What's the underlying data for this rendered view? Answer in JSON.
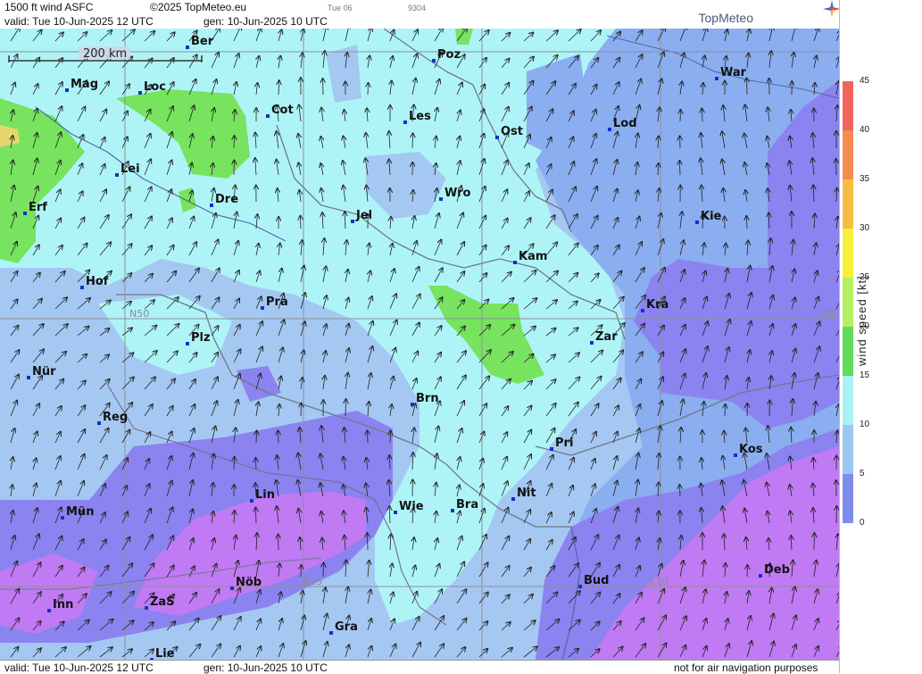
{
  "header": {
    "product": "1500 ft wind ASFC",
    "copyright": "©2025 TopMeteo.eu",
    "valid": "valid:  Tue  10-Jun-2025  12 UTC",
    "generated": "gen: 10-Jun-2025 10 UTC",
    "small_day": "Tue 06",
    "small_code": "9304",
    "brand": "TopMeteo"
  },
  "footer": {
    "valid": "valid:  Tue  10-Jun-2025  12 UTC",
    "generated": "gen: 10-Jun-2025 10 UTC",
    "disclaimer": "not for air navigation purposes"
  },
  "map": {
    "scale_label": "200 km",
    "grid_labels": [
      "N50",
      "N5",
      "E15",
      "E20"
    ],
    "cities": [
      {
        "name": "Ber"
      },
      {
        "name": "Poz"
      },
      {
        "name": "War"
      },
      {
        "name": "Mag"
      },
      {
        "name": "Loc"
      },
      {
        "name": "Cot"
      },
      {
        "name": "Les"
      },
      {
        "name": "Lod"
      },
      {
        "name": "Ost"
      },
      {
        "name": "Lei"
      },
      {
        "name": "Wro"
      },
      {
        "name": "Dre"
      },
      {
        "name": "Erf"
      },
      {
        "name": "Jel"
      },
      {
        "name": "Kie"
      },
      {
        "name": "Kam"
      },
      {
        "name": "Hof"
      },
      {
        "name": "Pra"
      },
      {
        "name": "Kra"
      },
      {
        "name": "Zar"
      },
      {
        "name": "Plz"
      },
      {
        "name": "Nür"
      },
      {
        "name": "Brn"
      },
      {
        "name": "Reg"
      },
      {
        "name": "Pri"
      },
      {
        "name": "Kos"
      },
      {
        "name": "Lin"
      },
      {
        "name": "Nit"
      },
      {
        "name": "Wie"
      },
      {
        "name": "Bra"
      },
      {
        "name": "Mün"
      },
      {
        "name": "Deb"
      },
      {
        "name": "Nöb"
      },
      {
        "name": "Bud"
      },
      {
        "name": "Inn"
      },
      {
        "name": "ZaS"
      },
      {
        "name": "Gra"
      },
      {
        "name": "Lie"
      }
    ]
  },
  "legend": {
    "title": "wind  speed  [kt]",
    "ticks": [
      "45",
      "40",
      "35",
      "30",
      "25",
      "20",
      "15",
      "10",
      "5",
      "0"
    ],
    "colors": [
      "#f0645a",
      "#f58c50",
      "#f7bd43",
      "#f5f03c",
      "#b7ef62",
      "#5fdc5a",
      "#a8f2f5",
      "#9bc8f0",
      "#7e8cee",
      "#c27cf2"
    ]
  },
  "colors": {
    "calm_purple": "#c07af3",
    "violet": "#8b83ef",
    "blue": "#8aaef0",
    "light_blue": "#a4c8f2",
    "cyan": "#aef4f7",
    "green": "#77e35f"
  }
}
